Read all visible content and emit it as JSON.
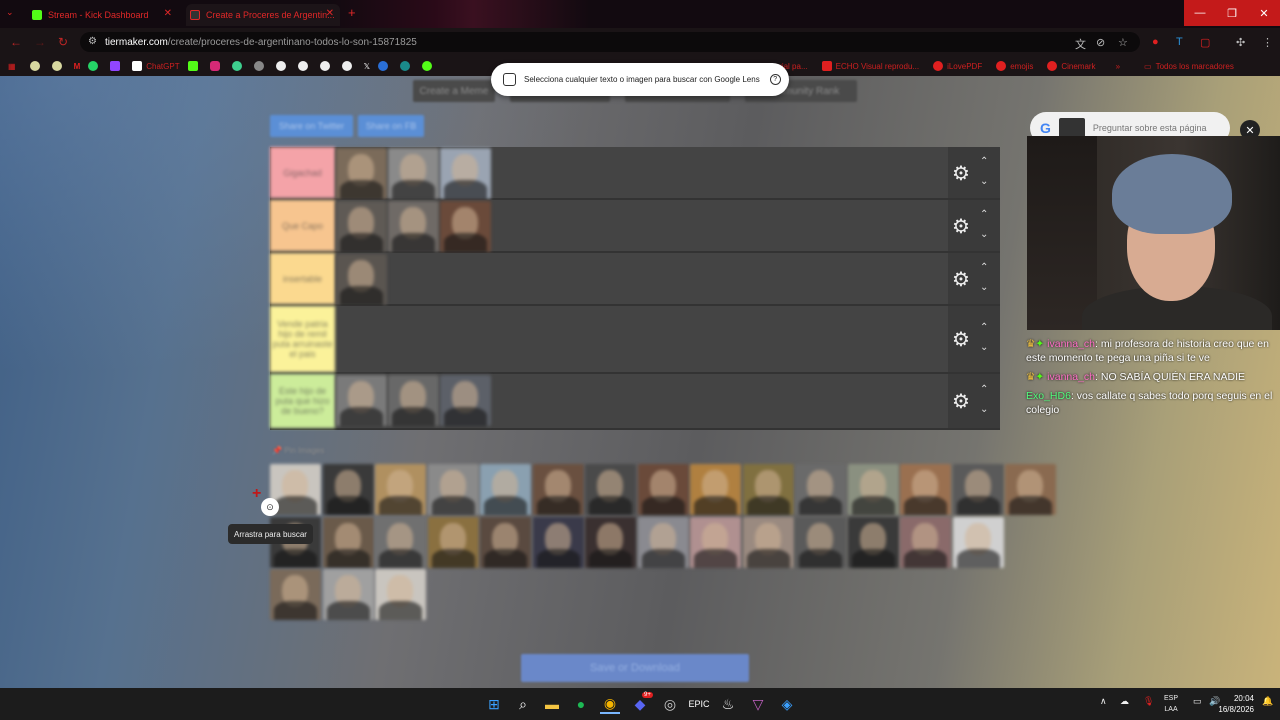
{
  "browser": {
    "tabs": [
      {
        "title": "Stream - Kick Dashboard"
      },
      {
        "title": "Create a Proceres de Argentin..."
      }
    ],
    "url_domain": "tiermaker.com",
    "url_path": "/create/proceres-de-argentinano-todos-lo-son-15871825",
    "window_controls": [
      "—",
      "❐",
      "✕"
    ],
    "bookmarks": [
      "ChatGPT",
      "",
      "",
      "",
      "",
      "",
      "",
      "",
      "",
      "",
      "",
      "",
      "",
      "ICSS3] Tutorial pa...",
      "ECHO Visual reprodu...",
      "iLovePDF",
      "emojis",
      "Cinemark",
      "Todos los marcadores"
    ]
  },
  "lens_bar": {
    "text": "Selecciona cualquier texto o imagen para buscar con Google Lens"
  },
  "tiermaker": {
    "top_nav": [
      "Create a Meme",
      "",
      "",
      "Community Rank"
    ],
    "share_buttons": [
      "Share on Twitter",
      "Share on FB"
    ],
    "tiers": [
      {
        "label": "Gigachad",
        "color": "#f4a3a8",
        "images": 3
      },
      {
        "label": "Que Capo",
        "color": "#f7c58f",
        "images": 3
      },
      {
        "label": "insertable",
        "color": "#fbd98f",
        "images": 1
      },
      {
        "label": "Vende patria hijo de remil puta arruinaste el pais",
        "color": "#fbf29a",
        "images": 0
      },
      {
        "label": "Este hijo de puta que hizo de bueno?",
        "color": "#ccec9a",
        "images": 3
      }
    ],
    "pin_label": "Pin Images",
    "pool_rows": [
      15,
      14,
      3
    ],
    "save_button": "Save or Download",
    "tooltip": "Arrastra para buscar"
  },
  "google_ask": {
    "placeholder": "Preguntar sobre esta página"
  },
  "chat": [
    {
      "user": "ivanna_ch",
      "user_color": "#ff6ec7",
      "badges": true,
      "text": "mi profesora de historia creo que en este momento te pega una piña si te ve"
    },
    {
      "user": "ivanna_ch",
      "user_color": "#ff6ec7",
      "badges": true,
      "text": "NO SABÍA QUIÉN ERA NADIE"
    },
    {
      "user": "Exo_HD6",
      "user_color": "#53fc7e",
      "badges": false,
      "text": "vos callate q sabes todo porq seguis en el colegio"
    }
  ],
  "taskbar": {
    "lang": "ESP",
    "lang2": "LAA",
    "time": "20:04",
    "date": "16/8/2026",
    "badge_count": "9+"
  }
}
